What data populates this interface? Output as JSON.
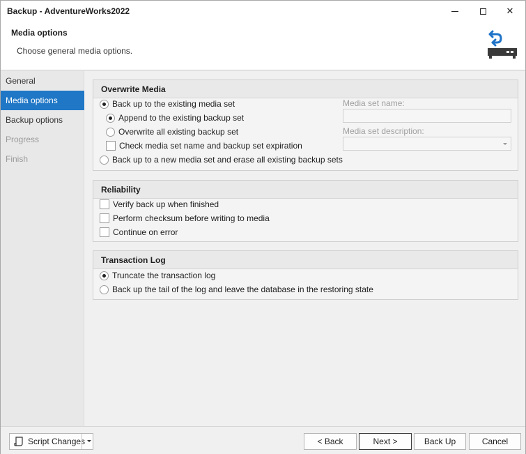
{
  "window": {
    "title": "Backup - AdventureWorks2022",
    "controls": {
      "minimize": "minimize",
      "maximize": "maximize",
      "close": "✕"
    }
  },
  "header": {
    "title": "Media options",
    "subtitle": "Choose general media options."
  },
  "sidebar": {
    "items": [
      {
        "label": "General",
        "state": "normal"
      },
      {
        "label": "Media options",
        "state": "active"
      },
      {
        "label": "Backup options",
        "state": "normal"
      },
      {
        "label": "Progress",
        "state": "disabled"
      },
      {
        "label": "Finish",
        "state": "disabled"
      }
    ]
  },
  "overwrite_media": {
    "title": "Overwrite Media",
    "existing_set_label": "Back up to the existing media set",
    "existing_set_checked": true,
    "append_label": "Append to the existing backup set",
    "append_checked": true,
    "overwrite_label": "Overwrite all existing backup set",
    "overwrite_checked": false,
    "check_expiration_label": "Check media set name and backup set expiration",
    "check_expiration_checked": false,
    "new_set_label": "Back up to a new media set and erase all existing backup sets",
    "new_set_checked": false,
    "media_set_name_label": "Media set name:",
    "media_set_name_value": "",
    "media_set_description_label": "Media set description:",
    "media_set_description_value": ""
  },
  "reliability": {
    "title": "Reliability",
    "verify_label": "Verify back up when finished",
    "checksum_label": "Perform checksum before writing to media",
    "continue_label": "Continue on error"
  },
  "transaction_log": {
    "title": "Transaction Log",
    "truncate_label": "Truncate the transaction log",
    "truncate_checked": true,
    "tail_label": "Back up the tail of the log and leave the database in the restoring state",
    "tail_checked": false
  },
  "footer": {
    "script_changes_label": "Script Changes",
    "back_label": "< Back",
    "next_label": "Next >",
    "backup_label": "Back Up",
    "cancel_label": "Cancel"
  },
  "colors": {
    "accent": "#1f77c6",
    "icon_blue": "#1e73c8",
    "icon_dark": "#3a3a3a"
  }
}
